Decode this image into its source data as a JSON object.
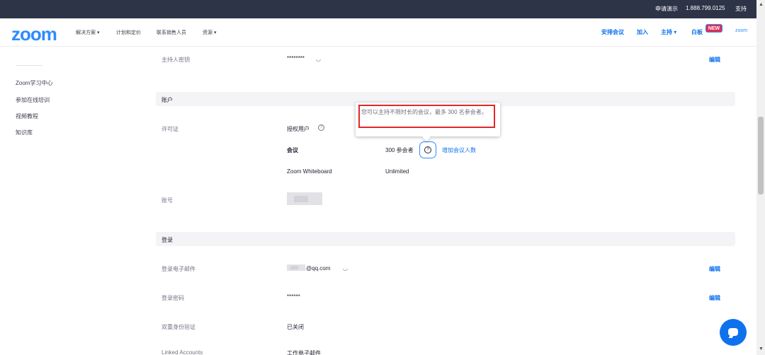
{
  "topbar": {
    "demo": "申请演示",
    "phone": "1.888.799.0125",
    "support": "支持"
  },
  "header": {
    "logo": "zoom",
    "nav": [
      "解决方案 ▾",
      "计划和定价",
      "联系销售人员",
      "资源 ▾"
    ],
    "right": {
      "schedule": "安排会议",
      "join": "加入",
      "host": "主持 ▾",
      "whiteboard": "白板",
      "new_badge": "NEW",
      "zoom": "zoom"
    }
  },
  "sidebar": {
    "items": [
      "Zoom学习中心",
      "参加在线培训",
      "视频教程",
      "知识库"
    ]
  },
  "profile": {
    "host_key_label": "主持人密钥",
    "host_key_value": "********",
    "edit": "编辑",
    "account_section": "账户",
    "license_label": "许可证",
    "licensed_user": "授权用户",
    "meeting_label": "会议",
    "meeting_value": "300 参会者",
    "add_participants": "增加会议人数",
    "whiteboard_label": "Zoom Whiteboard",
    "whiteboard_value": "Unlimited",
    "account_no_label": "账号",
    "login_section": "登录",
    "login_email_label": "登录电子邮件",
    "login_email_value": "@qq.com",
    "login_password_label": "登录密码",
    "login_password_value": "******",
    "two_factor_label": "双重身份验证",
    "two_factor_value": "已关闭",
    "linked_accounts_label": "Linked Accounts",
    "linked_accounts_value": "工作电子邮件"
  },
  "tooltip": {
    "text": "您可以主持不限时长的会议，最多 300 名参会者。"
  },
  "colors": {
    "brand": "#2d8cff",
    "link": "#0e72ed",
    "topbar": "#2d3447",
    "highlight": "#e02828"
  }
}
